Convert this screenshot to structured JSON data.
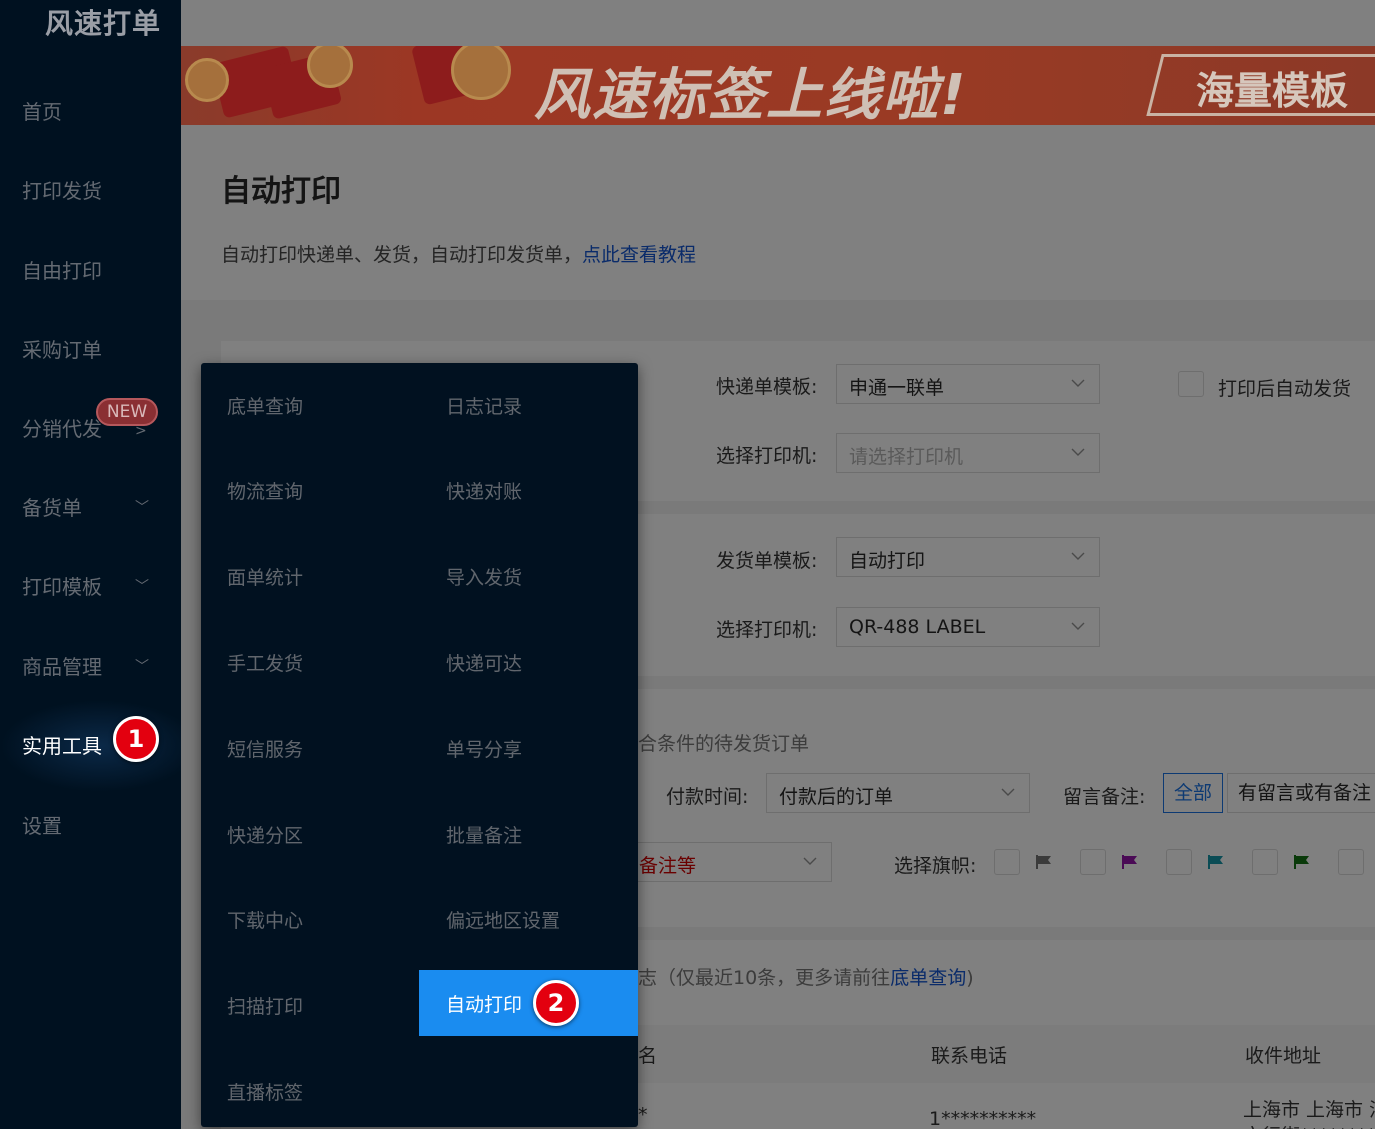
{
  "app": {
    "logo": "风速打单"
  },
  "sidebar": {
    "items": [
      {
        "label": "首页"
      },
      {
        "label": "打印发货"
      },
      {
        "label": "自由打印"
      },
      {
        "label": "采购订单"
      },
      {
        "label": "分销代发",
        "badge": "NEW",
        "arrow": ">"
      },
      {
        "label": "备货单",
        "arrow": "﹀"
      },
      {
        "label": "打印模板",
        "arrow": "﹀"
      },
      {
        "label": "商品管理",
        "arrow": "﹀"
      },
      {
        "label": "实用工具"
      },
      {
        "label": "设置"
      }
    ]
  },
  "banner": {
    "headline": "风速标签上线啦!",
    "tag": "海量模板"
  },
  "page": {
    "title": "自动打印",
    "description": "自动打印快递单、发货，自动打印发货单，",
    "tutorial_link": "点此查看教程"
  },
  "express": {
    "template_label": "快递单模板:",
    "template_value": "申通一联单",
    "printer_label": "选择打印机:",
    "printer_placeholder": "请选择打印机",
    "auto_ship_label": "打印后自动发货"
  },
  "invoice": {
    "template_label": "发货单模板:",
    "template_value": "自动打印",
    "printer_label": "选择打印机:",
    "printer_value": "QR-488 LABEL"
  },
  "filters": {
    "section_text": "合条件的待发货订单",
    "payment_label": "付款时间:",
    "payment_value": "付款后的订单",
    "remark_label": "留言备注:",
    "remark_options": [
      "全部",
      "有留言或有备注"
    ],
    "remark_select_value": "备注等",
    "flag_label": "选择旗帜:",
    "flag_colors": [
      "#3b3b3b",
      "#4a0a55",
      "#0b4c55",
      "#0a3a0a"
    ]
  },
  "log": {
    "text": "志（仅最近10条，更多请前往",
    "link": "底单查询",
    "tail": ")"
  },
  "table": {
    "headers": [
      "名",
      "联系电话",
      "收件地址"
    ],
    "row": {
      "name": "*",
      "phone": "1**********",
      "address": "上海市 上海市 浦",
      "address2": "文行街**********"
    }
  },
  "menu": {
    "items": [
      "底单查询",
      "日志记录",
      "物流查询",
      "快递对账",
      "面单统计",
      "导入发货",
      "手工发货",
      "快递可达",
      "短信服务",
      "单号分享",
      "快递分区",
      "批量备注",
      "下载中心",
      "偏远地区设置",
      "扫描打印",
      "自动打印",
      "直播标签"
    ]
  },
  "callouts": [
    "1",
    "2"
  ]
}
